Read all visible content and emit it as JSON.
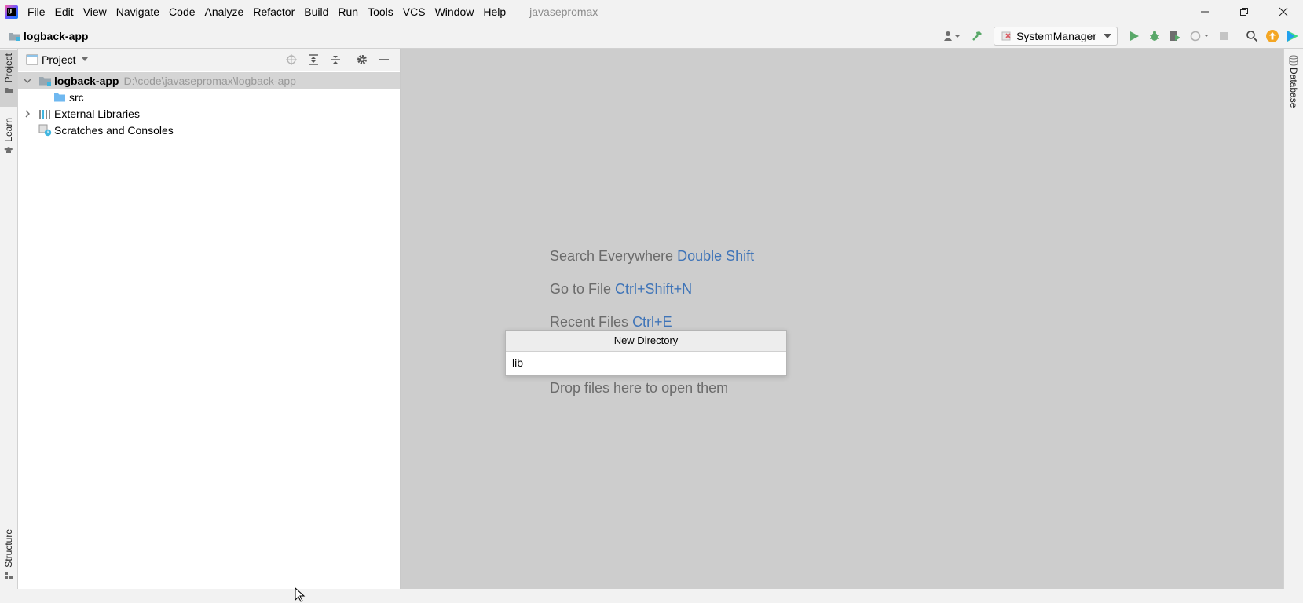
{
  "titlebar": {
    "logo_text": "IJ",
    "menu": [
      "File",
      "Edit",
      "View",
      "Navigate",
      "Code",
      "Analyze",
      "Refactor",
      "Build",
      "Run",
      "Tools",
      "VCS",
      "Window",
      "Help"
    ],
    "project_name": "javasepromax"
  },
  "navbar": {
    "breadcrumb": "logback-app",
    "run_config": "SystemManager"
  },
  "left_strip": {
    "tabs": [
      "Project",
      "Learn",
      "Structure"
    ]
  },
  "project_panel": {
    "title": "Project",
    "tree": [
      {
        "label": "logback-app",
        "hint": "D:\\code\\javasepromax\\logback-app"
      },
      {
        "label": "src"
      },
      {
        "label": "External Libraries"
      },
      {
        "label": "Scratches and Consoles"
      }
    ]
  },
  "editor": {
    "hints": [
      {
        "text": "Search Everywhere",
        "key": "Double Shift"
      },
      {
        "text": "Go to File",
        "key": "Ctrl+Shift+N"
      },
      {
        "text": "Recent Files",
        "key": "Ctrl+E"
      },
      {
        "text": "Drop files here to open them",
        "key": ""
      }
    ]
  },
  "popup": {
    "title": "New Directory",
    "value": "lib"
  },
  "right_strip": {
    "tab": "Database"
  },
  "colors": {
    "accent_blue": "#3f74b8",
    "folder_blue": "#6fb8f0",
    "run_green": "#59a869",
    "update_orange": "#f4a623"
  }
}
